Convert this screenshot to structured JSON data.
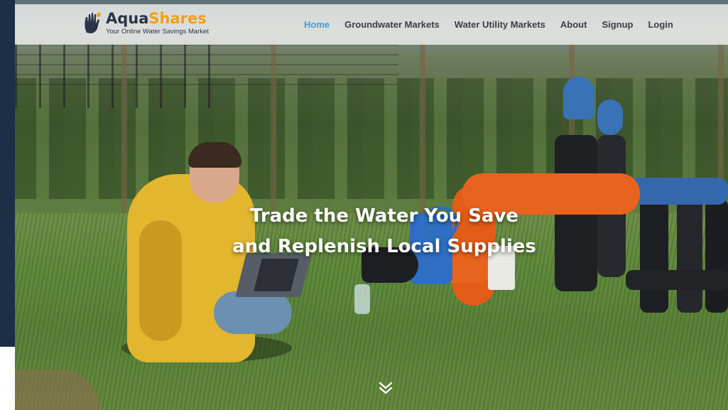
{
  "brand": {
    "name_part1": "Aqua",
    "name_part2": "Shares",
    "tagline": "Your Online Water Savings Market",
    "colors": {
      "primary": "#2b3346",
      "accent": "#f0a01a"
    },
    "icon": "hand-icon"
  },
  "nav": {
    "items": [
      {
        "label": "Home",
        "active": true
      },
      {
        "label": "Groundwater Markets",
        "active": false
      },
      {
        "label": "Water Utility Markets",
        "active": false
      },
      {
        "label": "About",
        "active": false
      },
      {
        "label": "Signup",
        "active": false
      },
      {
        "label": "Login",
        "active": false
      }
    ],
    "active_color": "#3aa0e0"
  },
  "hero": {
    "headline_line1": "Trade the Water You Save",
    "headline_line2": "and Replenish Local Supplies",
    "scroll_icon": "double-chevron-down-icon"
  }
}
